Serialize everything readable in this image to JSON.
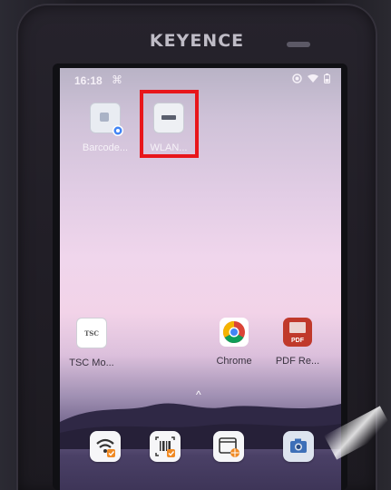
{
  "device": {
    "brand": "KEYENCE"
  },
  "status_bar": {
    "time": "16:18",
    "left_glyph": "⌘",
    "right_icons": [
      "record-icon",
      "wifi-icon",
      "battery-icon"
    ]
  },
  "home_apps": [
    {
      "label": "Barcode...",
      "icon": "barcode-app-icon"
    },
    {
      "label": "WLAN...",
      "icon": "wlan-app-icon"
    },
    {
      "label": "TSC Mo...",
      "icon": "tsc-icon"
    },
    {
      "label": "Chrome",
      "icon": "chrome-icon"
    },
    {
      "label": "PDF Re...",
      "icon": "pdf-icon"
    }
  ],
  "tsc_logo_text": "TSC",
  "pdf_logo_text": "PDF",
  "app_drawer_hint": "^",
  "dock": [
    {
      "icon": "wifi-settings-icon"
    },
    {
      "icon": "barcode-scan-icon"
    },
    {
      "icon": "browser-icon"
    },
    {
      "icon": "camera-icon"
    }
  ],
  "colors": {
    "highlight": "#e8161b",
    "chrome_red": "#db4437",
    "chrome_yellow": "#f4b400",
    "chrome_green": "#0f9d58",
    "chrome_blue": "#4285f4",
    "pdf_red": "#c0392b",
    "dock_badge_orange": "#f08a24"
  }
}
